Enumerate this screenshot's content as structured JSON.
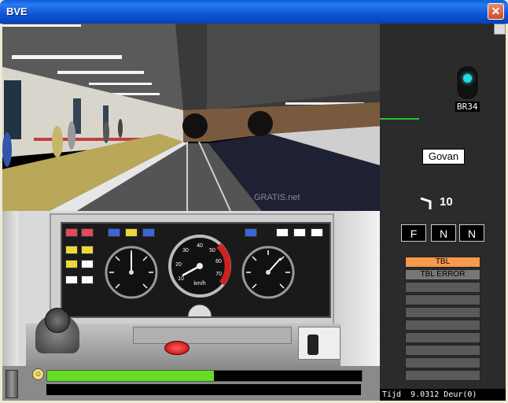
{
  "window": {
    "title": "BVE",
    "close_glyph": "✕"
  },
  "scene": {
    "watermark": "GRATIS.net"
  },
  "gauges": [
    {
      "name": "left-gauge",
      "needle_deg": 60
    },
    {
      "name": "speedometer",
      "unit": "km/h",
      "ticks": [
        "10",
        "20",
        "30",
        "40",
        "50",
        "60",
        "70"
      ],
      "needle_deg": -110,
      "redzone_from": 60
    },
    {
      "name": "right-gauge",
      "needle_deg": 40
    }
  ],
  "lamps_top": [
    {
      "color": "#e24a5a"
    },
    {
      "color": "#e24a5a"
    },
    {
      "color": "#3a66d6"
    },
    {
      "color": "#f0d83a"
    },
    {
      "color": "#3a66d6"
    },
    {
      "color": "#3a66d6"
    },
    {
      "color": "#ffffff"
    },
    {
      "color": "#ffffff"
    },
    {
      "color": "#ffffff"
    }
  ],
  "lamps_left": [
    {
      "color": "#f0d83a"
    },
    {
      "color": "#f0d83a"
    },
    {
      "color": "#f0d83a"
    },
    {
      "color": "#ffffff"
    },
    {
      "color": "#ffffff"
    },
    {
      "color": "#ffffff"
    }
  ],
  "status": {
    "progress": 0.53
  },
  "side": {
    "signal_label": "BR34",
    "station": "Govan",
    "speed_limit": "10",
    "reverser": [
      "F",
      "N",
      "N"
    ],
    "ats_panels": [
      {
        "label": "TBL",
        "color": "#f59a4a"
      },
      {
        "label": "TBL ERROR",
        "color": "#777777"
      },
      {
        "label": "",
        "color": "#5a5a5a"
      },
      {
        "label": "",
        "color": "#5a5a5a"
      },
      {
        "label": "",
        "color": "#5a5a5a"
      },
      {
        "label": "",
        "color": "#5a5a5a"
      },
      {
        "label": "",
        "color": "#5a5a5a"
      },
      {
        "label": "",
        "color": "#5a5a5a"
      },
      {
        "label": "",
        "color": "#5a5a5a"
      },
      {
        "label": "",
        "color": "#5a5a5a"
      }
    ],
    "clock_label": "Tijd",
    "clock_value": "9.0312",
    "door_label": "Deur(0)"
  }
}
